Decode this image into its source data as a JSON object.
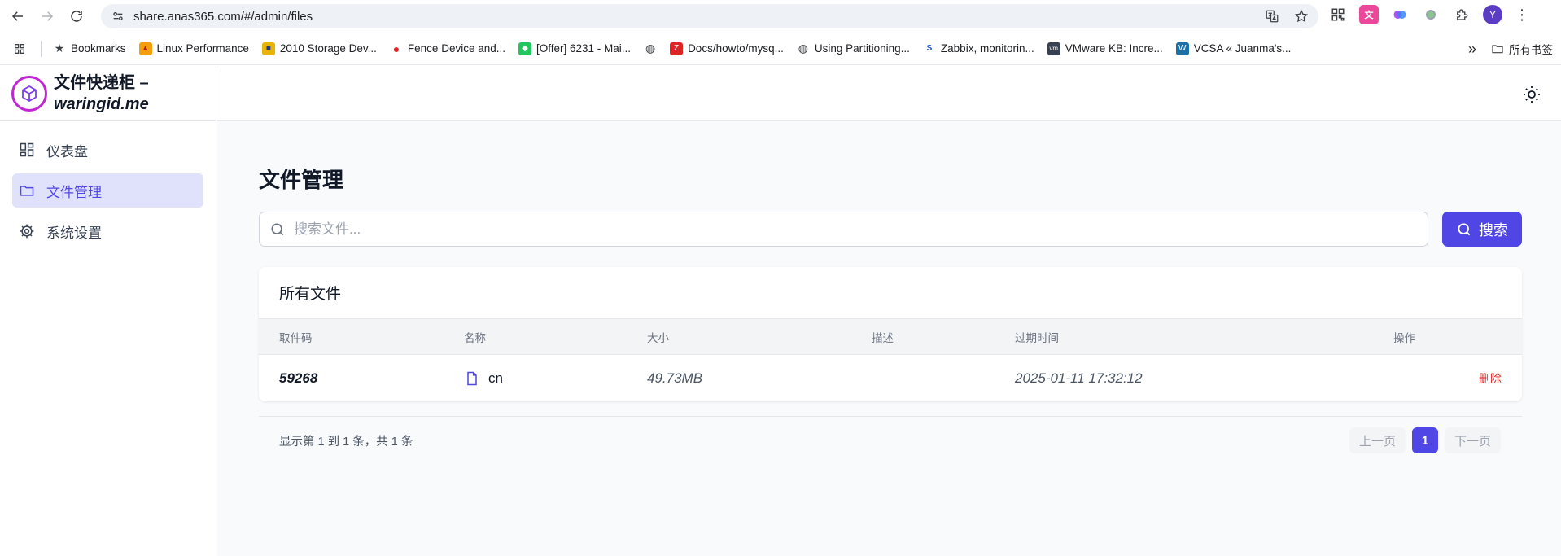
{
  "browser": {
    "url": "share.anas365.com/#/admin/files",
    "profile_initial": "Y",
    "bookmarks": [
      {
        "label": "Bookmarks"
      },
      {
        "label": "Linux Performance"
      },
      {
        "label": "2010 Storage Dev..."
      },
      {
        "label": "Fence Device and..."
      },
      {
        "label": "[Offer] 6231 - Mai..."
      },
      {
        "label": ""
      },
      {
        "label": "Docs/howto/mysq..."
      },
      {
        "label": "Using Partitioning..."
      },
      {
        "label": "Zabbix, monitorin..."
      },
      {
        "label": "VMware KB: Incre..."
      },
      {
        "label": "VCSA « Juanma's..."
      }
    ],
    "more_label": "»",
    "all_bookmarks_label": "所有书签"
  },
  "app": {
    "brand_cn": "文件快递柜 –",
    "brand_en": "waringid.me"
  },
  "sidebar": {
    "items": [
      {
        "label": "仪表盘",
        "active": false
      },
      {
        "label": "文件管理",
        "active": true
      },
      {
        "label": "系统设置",
        "active": false
      }
    ]
  },
  "main": {
    "title": "文件管理",
    "search": {
      "placeholder": "搜索文件...",
      "value": "",
      "button_label": "搜索"
    },
    "card_title": "所有文件",
    "columns": [
      "取件码",
      "名称",
      "大小",
      "描述",
      "过期时间",
      "操作"
    ],
    "rows": [
      {
        "code": "59268",
        "name": "cn",
        "size": "49.73MB",
        "description": "",
        "expires": "2025-01-11 17:32:12",
        "action": "删除"
      }
    ],
    "pagination": {
      "info": "显示第 1 到 1 条，共 1 条",
      "prev_label": "上一页",
      "current_page": "1",
      "next_label": "下一页"
    }
  },
  "colors": {
    "accent": "#4f46e5",
    "danger": "#dc2626",
    "active_bg": "#e0e1fb"
  }
}
